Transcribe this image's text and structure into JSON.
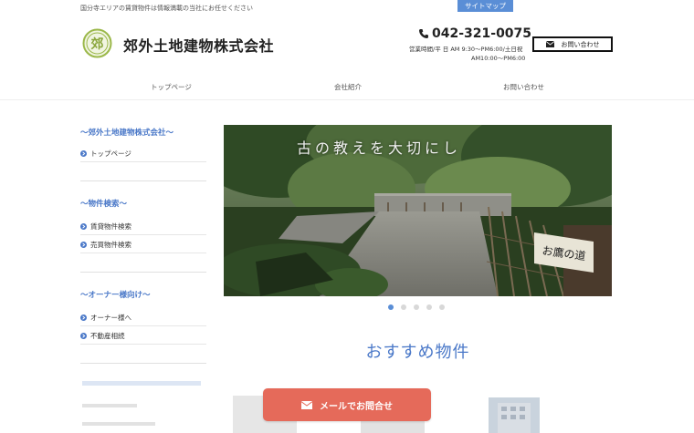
{
  "header": {
    "tagline": "国分寺エリアの賃貸物件は情報満載の当社にお任せください",
    "sitemap_label": "サイトマップ",
    "logo_glyph": "郊",
    "company_name": "郊外土地建物株式会社",
    "phone": "042-321-0075",
    "hours_line1": "営業時間/平 日 AM 9:30～PM6:00/土日祝",
    "hours_line2": "AM10:00～PM6:00",
    "contact_label": "お問い合わせ"
  },
  "nav": {
    "items": [
      {
        "label": "トップページ"
      },
      {
        "label": "会社紹介"
      },
      {
        "label": "お問い合わせ"
      }
    ]
  },
  "sidebar": {
    "sections": [
      {
        "title": "～郊外土地建物株式会社～",
        "items": [
          "トップページ"
        ]
      },
      {
        "title": "～物件検索～",
        "items": [
          "賃貸物件検索",
          "売買物件検索"
        ]
      },
      {
        "title": "～オーナー様向け～",
        "items": [
          "オーナー様へ",
          "不動産相続"
        ]
      }
    ]
  },
  "hero": {
    "caption": "古の教えを大切にし",
    "sign_text": "お鷹の道",
    "slide_count": 5,
    "active_slide": 1
  },
  "main": {
    "section_title": "おすすめ物件"
  },
  "cta": {
    "mail_label": "メールでお問合せ"
  },
  "colors": {
    "accent": "#4a78c8",
    "sitemap_bg": "#5a8ed6",
    "cta_bg": "#e56a5a",
    "logo_green": "#9bb84a"
  }
}
